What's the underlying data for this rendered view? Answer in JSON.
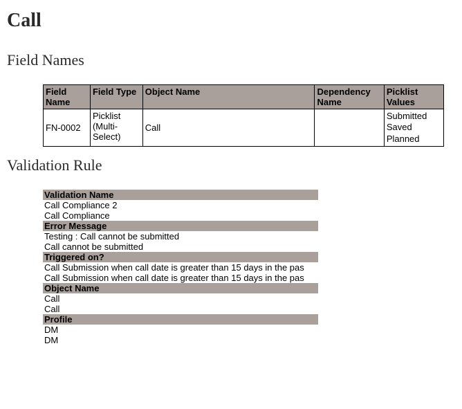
{
  "page": {
    "title": "Call"
  },
  "fieldNames": {
    "sectionTitle": "Field Names",
    "headers": {
      "fieldName": "Field Name",
      "fieldType": "Field Type",
      "objectName": "Object Name",
      "dependencyName": "Dependency Name",
      "picklistValues": "Picklist Values"
    },
    "rows": [
      {
        "fieldName": "FN-0002",
        "fieldType": "Picklist (Multi-Select)",
        "objectName": "Call",
        "dependencyName": "",
        "picklistValues": [
          "Submitted",
          "Saved",
          "Planned"
        ]
      }
    ]
  },
  "validationRule": {
    "sectionTitle": "Validation Rule",
    "headers": {
      "validationName": "Validation Name",
      "errorMessage": "Error Message",
      "triggeredOn": "Triggered on?",
      "objectName": "Object Name",
      "profile": "Profile"
    },
    "rows": {
      "validationName": [
        "Call Compliance 2",
        "Call Compliance"
      ],
      "errorMessage": [
        "Testing : Call cannot be submitted",
        "Call cannot be submitted"
      ],
      "triggeredOn": [
        "Call Submission when call date is greater than 15 days in the pas",
        "Call Submission when call date is greater than 15 days in the pas"
      ],
      "objectName": [
        "Call",
        "Call"
      ],
      "profile": [
        "DM",
        "DM"
      ]
    }
  }
}
